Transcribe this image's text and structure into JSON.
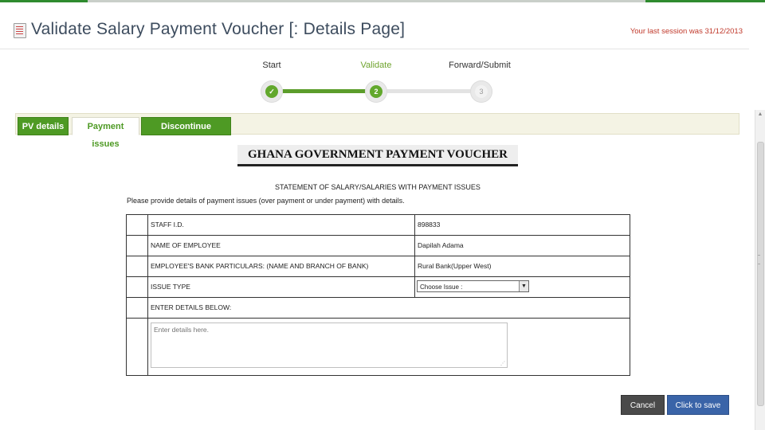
{
  "header": {
    "title": "Validate Salary Payment Voucher [: Details Page]",
    "session_text": "Your last session was 31/12/2013"
  },
  "wizard": {
    "steps": [
      {
        "label": "Start",
        "marker": "✓",
        "state": "done"
      },
      {
        "label": "Validate",
        "marker": "2",
        "state": "active"
      },
      {
        "label": "Forward/Submit",
        "marker": "3",
        "state": "pending"
      }
    ]
  },
  "tabs": [
    {
      "label": "PV details",
      "active": false
    },
    {
      "label": "Payment issues",
      "active": true
    },
    {
      "label": "Discontinue payment",
      "active": false
    }
  ],
  "voucher": {
    "title": "GHANA GOVERNMENT PAYMENT VOUCHER",
    "subtitle": "STATEMENT OF SALARY/SALARIES WITH PAYMENT ISSUES",
    "instruction": "Please provide details of payment issues (over payment or under payment) with details."
  },
  "form": {
    "rows": [
      {
        "label": "STAFF I.D.",
        "value": "898833"
      },
      {
        "label": "NAME OF EMPLOYEE",
        "value": "Dapilah Adama"
      },
      {
        "label": "EMPLOYEE'S BANK PARTICULARS: (NAME AND BRANCH OF BANK)",
        "value": "Rural Bank(Upper West)"
      },
      {
        "label": "ISSUE TYPE",
        "value": ""
      }
    ],
    "issue_select": "Choose Issue :",
    "details_label": "ENTER DETAILS BELOW:",
    "details_placeholder": "Enter details here."
  },
  "buttons": {
    "cancel": "Cancel",
    "save": "Click to save"
  },
  "colors": {
    "accent_green": "#4e9a24",
    "save_blue": "#3a64a8",
    "session_red": "#c0392b"
  }
}
